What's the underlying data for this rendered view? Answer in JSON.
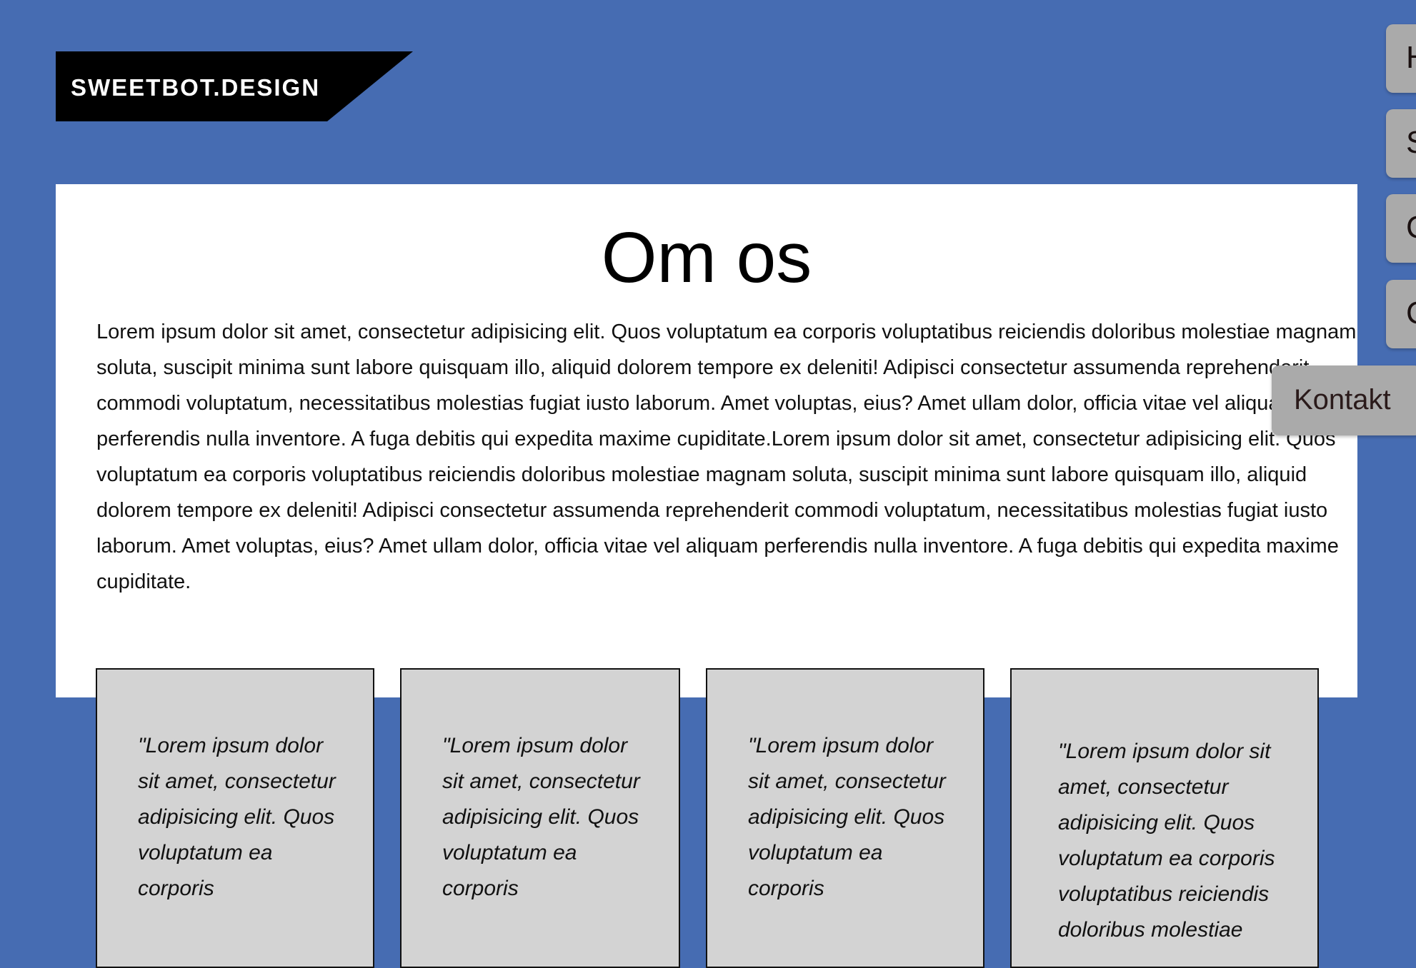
{
  "logo": {
    "text": "SWEETBOT.DESIGN"
  },
  "page": {
    "title": "Om os",
    "intro": "Lorem ipsum dolor sit amet, consectetur adipisicing elit. Quos voluptatum ea corporis voluptatibus reiciendis doloribus molestiae magnam soluta, suscipit minima sunt labore quisquam illo, aliquid dolorem tempore ex deleniti! Adipisci consectetur assumenda reprehenderit commodi voluptatum, necessitatibus molestias fugiat iusto laborum. Amet voluptas, eius? Amet ullam dolor, officia vitae vel aliquam perferendis nulla inventore. A fuga debitis qui expedita maxime cupiditate.Lorem ipsum dolor sit amet, consectetur adipisicing elit. Quos voluptatum ea corporis voluptatibus reiciendis doloribus molestiae magnam soluta, suscipit minima sunt labore quisquam illo, aliquid dolorem tempore ex deleniti! Adipisci consectetur assumenda reprehenderit commodi voluptatum, necessitatibus molestias fugiat iusto laborum. Amet voluptas, eius? Amet ullam dolor, officia vitae vel aliquam perferendis nulla inventore. A fuga debitis qui expedita maxime cupiditate."
  },
  "cards": [
    {
      "quote": "\"Lorem ipsum dolor sit amet, consectetur adipisicing elit. Quos voluptatum ea corporis"
    },
    {
      "quote": "\"Lorem ipsum dolor sit amet, consectetur adipisicing elit. Quos voluptatum ea corporis"
    },
    {
      "quote": "\"Lorem ipsum dolor sit amet, consectetur adipisicing elit. Quos voluptatum ea corporis"
    },
    {
      "quote": "\"Lorem ipsum dolor sit amet, consectetur adipisicing elit. Quos voluptatum ea corporis voluptatibus reiciendis doloribus molestiae"
    }
  ],
  "nav": {
    "items": [
      {
        "label": "H"
      },
      {
        "label": "S"
      },
      {
        "label": "C"
      },
      {
        "label": "C"
      }
    ],
    "contact_label": "Kontakt"
  },
  "colors": {
    "background": "#466cb2",
    "logo_bg": "#000000",
    "card_bg": "#d3d3d3",
    "tab_bg": "#aaaaaa"
  }
}
